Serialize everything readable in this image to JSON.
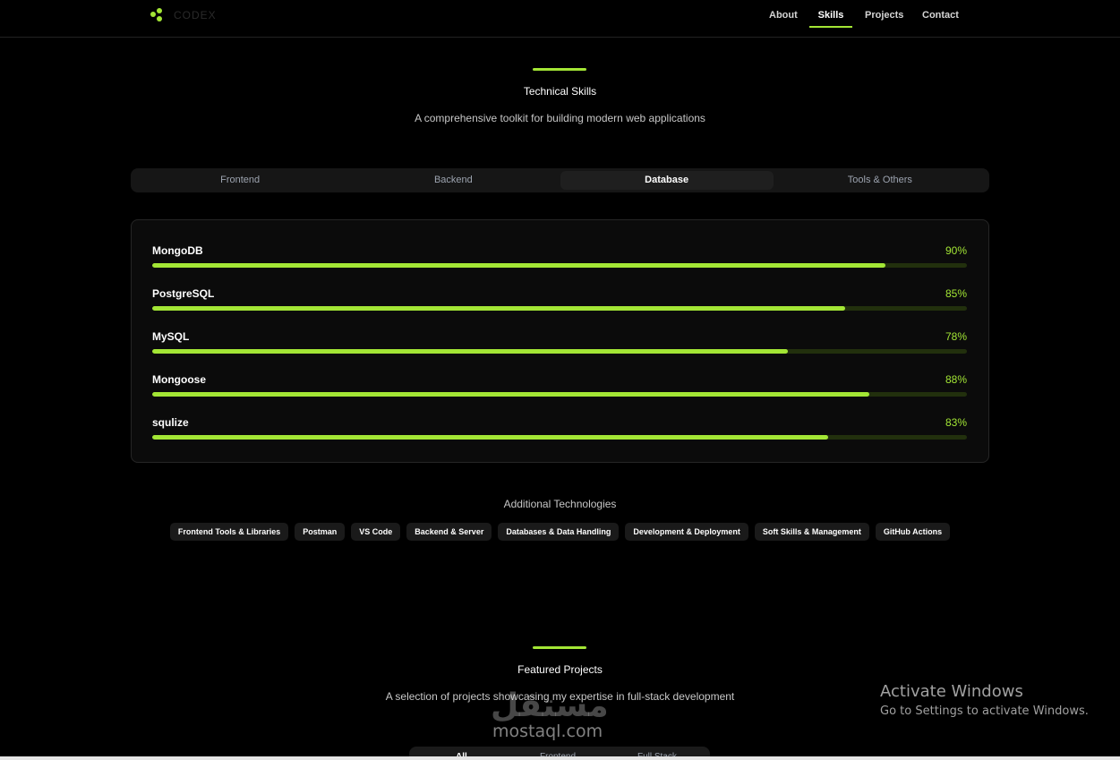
{
  "header": {
    "logo_text": "CODEX",
    "nav": [
      {
        "label": "About"
      },
      {
        "label": "Skills",
        "active": true
      },
      {
        "label": "Projects"
      },
      {
        "label": "Contact"
      }
    ]
  },
  "skills_section": {
    "title": "Technical Skills",
    "subtitle": "A comprehensive toolkit for building modern web applications",
    "tabs": [
      {
        "label": "Frontend"
      },
      {
        "label": "Backend"
      },
      {
        "label": "Database",
        "active": true
      },
      {
        "label": "Tools & Others"
      }
    ],
    "skills": [
      {
        "name": "MongoDB",
        "percent_label": "90%",
        "level": 0.9
      },
      {
        "name": "PostgreSQL",
        "percent_label": "85%",
        "level": 0.85
      },
      {
        "name": "MySQL",
        "percent_label": "78%",
        "level": 0.78
      },
      {
        "name": "Mongoose",
        "percent_label": "88%",
        "level": 0.88
      },
      {
        "name": "squlize",
        "percent_label": "83%",
        "level": 0.83
      }
    ],
    "additional_title": "Additional Technologies",
    "additional": [
      "Frontend Tools & Libraries",
      "Postman",
      "VS Code",
      "Backend & Server",
      "Databases & Data Handling",
      "Development & Deployment",
      "Soft Skills & Management",
      "GitHub Actions"
    ]
  },
  "projects_section": {
    "title": "Featured Projects",
    "subtitle": "A selection of projects showcasing my expertise in full-stack development",
    "filters": [
      {
        "label": "All",
        "active": true
      },
      {
        "label": "Frontend"
      },
      {
        "label": "Full Stack"
      }
    ]
  },
  "watermark": {
    "arabic": "مستقل",
    "latin": "mostaql.com"
  },
  "windows_activation": {
    "title": "Activate Windows",
    "subtitle": "Go to Settings to activate Windows."
  },
  "colors": {
    "accent": "#a3e635",
    "background": "#000000",
    "track": "#22300d"
  }
}
